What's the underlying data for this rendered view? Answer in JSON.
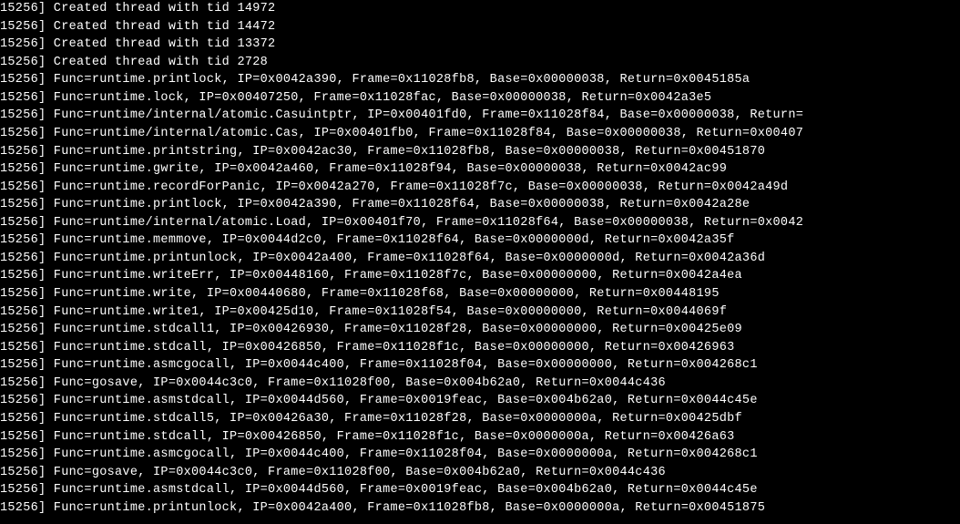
{
  "lines": [
    {
      "text": "15256] Created thread with tid 14972"
    },
    {
      "text": "15256] Created thread with tid 14472"
    },
    {
      "text": "15256] Created thread with tid 13372"
    },
    {
      "text": "15256] Created thread with tid 2728"
    },
    {
      "text": "15256] Func=runtime.printlock, IP=0x0042a390, Frame=0x11028fb8, Base=0x00000038, Return=0x0045185a"
    },
    {
      "text": "15256] Func=runtime.lock, IP=0x00407250, Frame=0x11028fac, Base=0x00000038, Return=0x0042a3e5"
    },
    {
      "text": "15256] Func=runtime/internal/atomic.Casuintptr, IP=0x00401fd0, Frame=0x11028f84, Base=0x00000038, Return="
    },
    {
      "text": "15256] Func=runtime/internal/atomic.Cas, IP=0x00401fb0, Frame=0x11028f84, Base=0x00000038, Return=0x00407"
    },
    {
      "text": "15256] Func=runtime.printstring, IP=0x0042ac30, Frame=0x11028fb8, Base=0x00000038, Return=0x00451870"
    },
    {
      "text": "15256] Func=runtime.gwrite, IP=0x0042a460, Frame=0x11028f94, Base=0x00000038, Return=0x0042ac99"
    },
    {
      "text": "15256] Func=runtime.recordForPanic, IP=0x0042a270, Frame=0x11028f7c, Base=0x00000038, Return=0x0042a49d"
    },
    {
      "text": "15256] Func=runtime.printlock, IP=0x0042a390, Frame=0x11028f64, Base=0x00000038, Return=0x0042a28e"
    },
    {
      "text": "15256] Func=runtime/internal/atomic.Load, IP=0x00401f70, Frame=0x11028f64, Base=0x00000038, Return=0x0042"
    },
    {
      "text": "15256] Func=runtime.memmove, IP=0x0044d2c0, Frame=0x11028f64, Base=0x0000000d, Return=0x0042a35f"
    },
    {
      "text": "15256] Func=runtime.printunlock, IP=0x0042a400, Frame=0x11028f64, Base=0x0000000d, Return=0x0042a36d"
    },
    {
      "text": "15256] Func=runtime.writeErr, IP=0x00448160, Frame=0x11028f7c, Base=0x00000000, Return=0x0042a4ea"
    },
    {
      "text": "15256] Func=runtime.write, IP=0x00440680, Frame=0x11028f68, Base=0x00000000, Return=0x00448195"
    },
    {
      "text": "15256] Func=runtime.write1, IP=0x00425d10, Frame=0x11028f54, Base=0x00000000, Return=0x0044069f"
    },
    {
      "text": "15256] Func=runtime.stdcall1, IP=0x00426930, Frame=0x11028f28, Base=0x00000000, Return=0x00425e09"
    },
    {
      "text": "15256] Func=runtime.stdcall, IP=0x00426850, Frame=0x11028f1c, Base=0x00000000, Return=0x00426963"
    },
    {
      "text": "15256] Func=runtime.asmcgocall, IP=0x0044c400, Frame=0x11028f04, Base=0x00000000, Return=0x004268c1"
    },
    {
      "text": "15256] Func=gosave, IP=0x0044c3c0, Frame=0x11028f00, Base=0x004b62a0, Return=0x0044c436"
    },
    {
      "text": "15256] Func=runtime.asmstdcall, IP=0x0044d560, Frame=0x0019feac, Base=0x004b62a0, Return=0x0044c45e"
    },
    {
      "text": "15256] Func=runtime.stdcall5, IP=0x00426a30, Frame=0x11028f28, Base=0x0000000a, Return=0x00425dbf"
    },
    {
      "text": "15256] Func=runtime.stdcall, IP=0x00426850, Frame=0x11028f1c, Base=0x0000000a, Return=0x00426a63"
    },
    {
      "text": "15256] Func=runtime.asmcgocall, IP=0x0044c400, Frame=0x11028f04, Base=0x0000000a, Return=0x004268c1"
    },
    {
      "text": "15256] Func=gosave, IP=0x0044c3c0, Frame=0x11028f00, Base=0x004b62a0, Return=0x0044c436"
    },
    {
      "text": "15256] Func=runtime.asmstdcall, IP=0x0044d560, Frame=0x0019feac, Base=0x004b62a0, Return=0x0044c45e"
    },
    {
      "text": "15256] Func=runtime.printunlock, IP=0x0042a400, Frame=0x11028fb8, Base=0x0000000a, Return=0x00451875"
    }
  ]
}
